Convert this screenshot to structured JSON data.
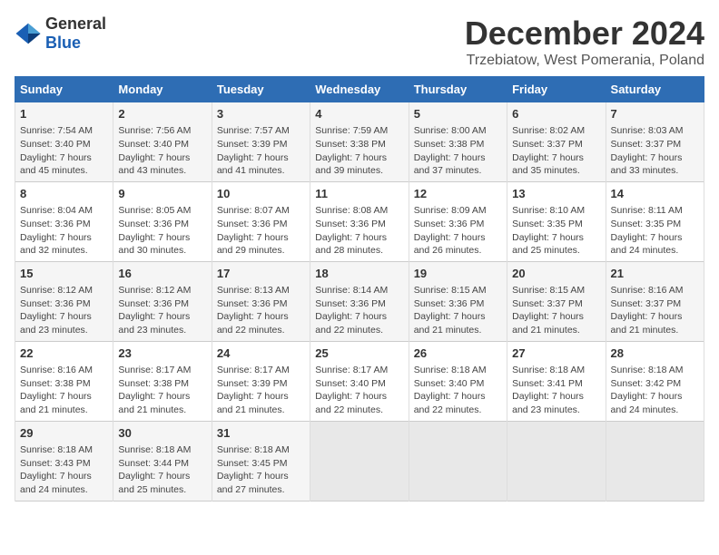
{
  "logo": {
    "general": "General",
    "blue": "Blue"
  },
  "title": "December 2024",
  "subtitle": "Trzebiatow, West Pomerania, Poland",
  "days_of_week": [
    "Sunday",
    "Monday",
    "Tuesday",
    "Wednesday",
    "Thursday",
    "Friday",
    "Saturday"
  ],
  "weeks": [
    [
      {
        "day": "1",
        "sunrise": "7:54 AM",
        "sunset": "3:40 PM",
        "daylight": "7 hours and 45 minutes."
      },
      {
        "day": "2",
        "sunrise": "7:56 AM",
        "sunset": "3:40 PM",
        "daylight": "7 hours and 43 minutes."
      },
      {
        "day": "3",
        "sunrise": "7:57 AM",
        "sunset": "3:39 PM",
        "daylight": "7 hours and 41 minutes."
      },
      {
        "day": "4",
        "sunrise": "7:59 AM",
        "sunset": "3:38 PM",
        "daylight": "7 hours and 39 minutes."
      },
      {
        "day": "5",
        "sunrise": "8:00 AM",
        "sunset": "3:38 PM",
        "daylight": "7 hours and 37 minutes."
      },
      {
        "day": "6",
        "sunrise": "8:02 AM",
        "sunset": "3:37 PM",
        "daylight": "7 hours and 35 minutes."
      },
      {
        "day": "7",
        "sunrise": "8:03 AM",
        "sunset": "3:37 PM",
        "daylight": "7 hours and 33 minutes."
      }
    ],
    [
      {
        "day": "8",
        "sunrise": "8:04 AM",
        "sunset": "3:36 PM",
        "daylight": "7 hours and 32 minutes."
      },
      {
        "day": "9",
        "sunrise": "8:05 AM",
        "sunset": "3:36 PM",
        "daylight": "7 hours and 30 minutes."
      },
      {
        "day": "10",
        "sunrise": "8:07 AM",
        "sunset": "3:36 PM",
        "daylight": "7 hours and 29 minutes."
      },
      {
        "day": "11",
        "sunrise": "8:08 AM",
        "sunset": "3:36 PM",
        "daylight": "7 hours and 28 minutes."
      },
      {
        "day": "12",
        "sunrise": "8:09 AM",
        "sunset": "3:36 PM",
        "daylight": "7 hours and 26 minutes."
      },
      {
        "day": "13",
        "sunrise": "8:10 AM",
        "sunset": "3:35 PM",
        "daylight": "7 hours and 25 minutes."
      },
      {
        "day": "14",
        "sunrise": "8:11 AM",
        "sunset": "3:35 PM",
        "daylight": "7 hours and 24 minutes."
      }
    ],
    [
      {
        "day": "15",
        "sunrise": "8:12 AM",
        "sunset": "3:36 PM",
        "daylight": "7 hours and 23 minutes."
      },
      {
        "day": "16",
        "sunrise": "8:12 AM",
        "sunset": "3:36 PM",
        "daylight": "7 hours and 23 minutes."
      },
      {
        "day": "17",
        "sunrise": "8:13 AM",
        "sunset": "3:36 PM",
        "daylight": "7 hours and 22 minutes."
      },
      {
        "day": "18",
        "sunrise": "8:14 AM",
        "sunset": "3:36 PM",
        "daylight": "7 hours and 22 minutes."
      },
      {
        "day": "19",
        "sunrise": "8:15 AM",
        "sunset": "3:36 PM",
        "daylight": "7 hours and 21 minutes."
      },
      {
        "day": "20",
        "sunrise": "8:15 AM",
        "sunset": "3:37 PM",
        "daylight": "7 hours and 21 minutes."
      },
      {
        "day": "21",
        "sunrise": "8:16 AM",
        "sunset": "3:37 PM",
        "daylight": "7 hours and 21 minutes."
      }
    ],
    [
      {
        "day": "22",
        "sunrise": "8:16 AM",
        "sunset": "3:38 PM",
        "daylight": "7 hours and 21 minutes."
      },
      {
        "day": "23",
        "sunrise": "8:17 AM",
        "sunset": "3:38 PM",
        "daylight": "7 hours and 21 minutes."
      },
      {
        "day": "24",
        "sunrise": "8:17 AM",
        "sunset": "3:39 PM",
        "daylight": "7 hours and 21 minutes."
      },
      {
        "day": "25",
        "sunrise": "8:17 AM",
        "sunset": "3:40 PM",
        "daylight": "7 hours and 22 minutes."
      },
      {
        "day": "26",
        "sunrise": "8:18 AM",
        "sunset": "3:40 PM",
        "daylight": "7 hours and 22 minutes."
      },
      {
        "day": "27",
        "sunrise": "8:18 AM",
        "sunset": "3:41 PM",
        "daylight": "7 hours and 23 minutes."
      },
      {
        "day": "28",
        "sunrise": "8:18 AM",
        "sunset": "3:42 PM",
        "daylight": "7 hours and 24 minutes."
      }
    ],
    [
      {
        "day": "29",
        "sunrise": "8:18 AM",
        "sunset": "3:43 PM",
        "daylight": "7 hours and 24 minutes."
      },
      {
        "day": "30",
        "sunrise": "8:18 AM",
        "sunset": "3:44 PM",
        "daylight": "7 hours and 25 minutes."
      },
      {
        "day": "31",
        "sunrise": "8:18 AM",
        "sunset": "3:45 PM",
        "daylight": "7 hours and 27 minutes."
      },
      null,
      null,
      null,
      null
    ]
  ],
  "labels": {
    "sunrise": "Sunrise:",
    "sunset": "Sunset:",
    "daylight": "Daylight:"
  }
}
